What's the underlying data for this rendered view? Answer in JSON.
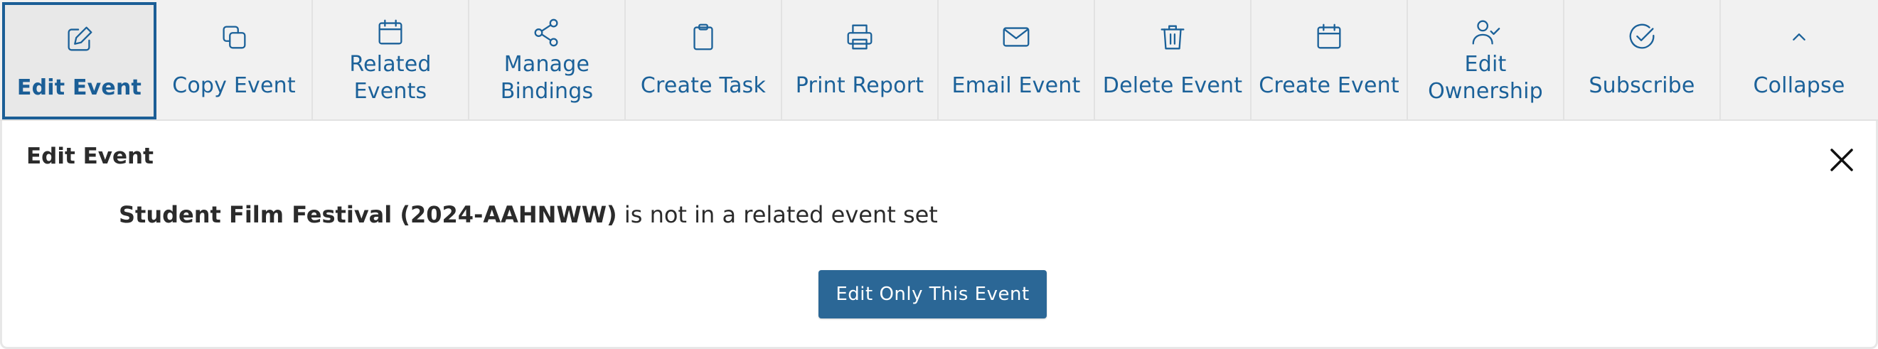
{
  "toolbar": {
    "items": [
      {
        "label_lines": [
          "Edit Event"
        ],
        "icon": "edit-icon",
        "active": true
      },
      {
        "label_lines": [
          "Copy Event"
        ],
        "icon": "copy-icon"
      },
      {
        "label_lines": [
          "Related",
          "Events"
        ],
        "icon": "calendar-icon"
      },
      {
        "label_lines": [
          "Manage",
          "Bindings"
        ],
        "icon": "share-icon"
      },
      {
        "label_lines": [
          "Create Task"
        ],
        "icon": "clipboard-icon"
      },
      {
        "label_lines": [
          "Print Report"
        ],
        "icon": "printer-icon"
      },
      {
        "label_lines": [
          "Email Event"
        ],
        "icon": "envelope-icon"
      },
      {
        "label_lines": [
          "Delete Event"
        ],
        "icon": "trash-icon"
      },
      {
        "label_lines": [
          "Create Event"
        ],
        "icon": "calendar-icon"
      },
      {
        "label_lines": [
          "Edit",
          "Ownership"
        ],
        "icon": "user-check-icon"
      },
      {
        "label_lines": [
          "Subscribe"
        ],
        "icon": "check-circle-icon"
      },
      {
        "label_lines": [
          "Collapse"
        ],
        "icon": "chevron-up-icon"
      }
    ]
  },
  "panel": {
    "title": "Edit Event",
    "event_name": "Student Film Festival (2024-AAHNWW)",
    "message_rest": " is not in a related event set",
    "button_label": "Edit Only This Event"
  },
  "colors": {
    "accent": "#1b6199",
    "button": "#2b6796",
    "toolbar_bg": "#f1f1f1"
  }
}
